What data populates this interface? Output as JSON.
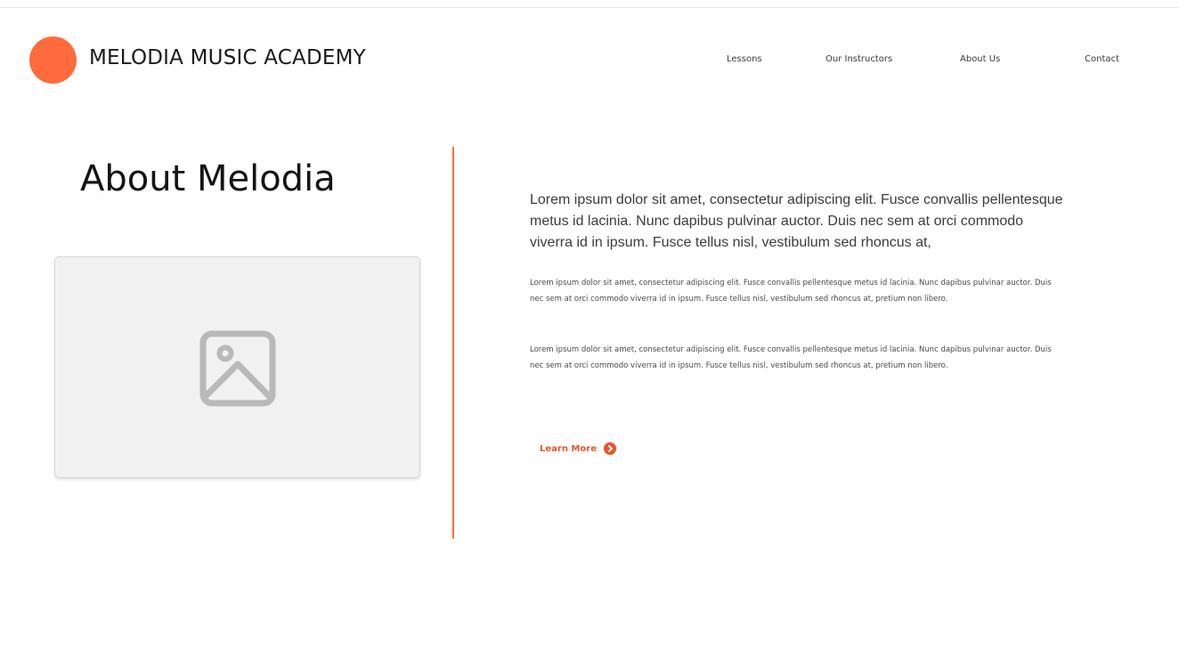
{
  "colors": {
    "accent": "#ff6b3d",
    "link": "#e8552a",
    "image_icon": "#b9b9b9"
  },
  "brand": {
    "name": "MELODIA MUSIC ACADEMY",
    "logo_icon": "orange-circle-logo"
  },
  "nav": {
    "items": [
      "Lessons",
      "Our Instructors",
      "About Us",
      "Contact"
    ]
  },
  "about": {
    "title": "About Melodia",
    "image_placeholder_icon": "image-placeholder-icon",
    "lead": "Lorem ipsum dolor sit amet, consectetur adipiscing elit. Fusce convallis pellentesque metus id lacinia. Nunc dapibus pulvinar auctor. Duis nec sem at orci commodo viverra id in ipsum. Fusce tellus nisl, vestibulum sed rhoncus at,",
    "paragraphs": [
      "Lorem ipsum dolor sit amet, consectetur adipiscing elit. Fusce convallis pellentesque metus id lacinia. Nunc dapibus pulvinar auctor. Duis nec sem at orci commodo viverra id in ipsum. Fusce tellus nisl, vestibulum sed rhoncus at, pretium non libero.",
      "Lorem ipsum dolor sit amet, consectetur adipiscing elit. Fusce convallis pellentesque metus id lacinia. Nunc dapibus pulvinar auctor. Duis nec sem at orci commodo viverra id in ipsum. Fusce tellus nisl, vestibulum sed rhoncus at, pretium non libero."
    ],
    "learn_more_label": "Learn More",
    "learn_more_icon": "chevron-right-circle-icon"
  }
}
